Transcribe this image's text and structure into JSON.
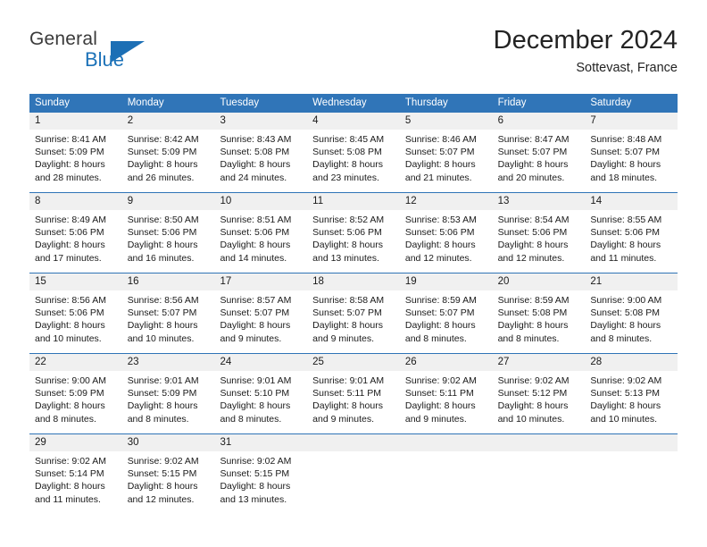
{
  "brand": {
    "word1": "General",
    "word2": "Blue",
    "logo_icon": "blue-triangle-icon",
    "accent_color": "#1c72b8"
  },
  "header": {
    "title": "December 2024",
    "subtitle": "Sottevast, France"
  },
  "theme": {
    "header_row_color": "#3075b8",
    "day_band_color": "#f0f0f0",
    "grid_line_color": "#2f74b6",
    "text_color": "#1a1a1a"
  },
  "calendar": {
    "weekday_headers": [
      "Sunday",
      "Monday",
      "Tuesday",
      "Wednesday",
      "Thursday",
      "Friday",
      "Saturday"
    ],
    "weeks": [
      [
        {
          "day": "1",
          "lines": [
            "Sunrise: 8:41 AM",
            "Sunset: 5:09 PM",
            "Daylight: 8 hours",
            "and 28 minutes."
          ]
        },
        {
          "day": "2",
          "lines": [
            "Sunrise: 8:42 AM",
            "Sunset: 5:09 PM",
            "Daylight: 8 hours",
            "and 26 minutes."
          ]
        },
        {
          "day": "3",
          "lines": [
            "Sunrise: 8:43 AM",
            "Sunset: 5:08 PM",
            "Daylight: 8 hours",
            "and 24 minutes."
          ]
        },
        {
          "day": "4",
          "lines": [
            "Sunrise: 8:45 AM",
            "Sunset: 5:08 PM",
            "Daylight: 8 hours",
            "and 23 minutes."
          ]
        },
        {
          "day": "5",
          "lines": [
            "Sunrise: 8:46 AM",
            "Sunset: 5:07 PM",
            "Daylight: 8 hours",
            "and 21 minutes."
          ]
        },
        {
          "day": "6",
          "lines": [
            "Sunrise: 8:47 AM",
            "Sunset: 5:07 PM",
            "Daylight: 8 hours",
            "and 20 minutes."
          ]
        },
        {
          "day": "7",
          "lines": [
            "Sunrise: 8:48 AM",
            "Sunset: 5:07 PM",
            "Daylight: 8 hours",
            "and 18 minutes."
          ]
        }
      ],
      [
        {
          "day": "8",
          "lines": [
            "Sunrise: 8:49 AM",
            "Sunset: 5:06 PM",
            "Daylight: 8 hours",
            "and 17 minutes."
          ]
        },
        {
          "day": "9",
          "lines": [
            "Sunrise: 8:50 AM",
            "Sunset: 5:06 PM",
            "Daylight: 8 hours",
            "and 16 minutes."
          ]
        },
        {
          "day": "10",
          "lines": [
            "Sunrise: 8:51 AM",
            "Sunset: 5:06 PM",
            "Daylight: 8 hours",
            "and 14 minutes."
          ]
        },
        {
          "day": "11",
          "lines": [
            "Sunrise: 8:52 AM",
            "Sunset: 5:06 PM",
            "Daylight: 8 hours",
            "and 13 minutes."
          ]
        },
        {
          "day": "12",
          "lines": [
            "Sunrise: 8:53 AM",
            "Sunset: 5:06 PM",
            "Daylight: 8 hours",
            "and 12 minutes."
          ]
        },
        {
          "day": "13",
          "lines": [
            "Sunrise: 8:54 AM",
            "Sunset: 5:06 PM",
            "Daylight: 8 hours",
            "and 12 minutes."
          ]
        },
        {
          "day": "14",
          "lines": [
            "Sunrise: 8:55 AM",
            "Sunset: 5:06 PM",
            "Daylight: 8 hours",
            "and 11 minutes."
          ]
        }
      ],
      [
        {
          "day": "15",
          "lines": [
            "Sunrise: 8:56 AM",
            "Sunset: 5:06 PM",
            "Daylight: 8 hours",
            "and 10 minutes."
          ]
        },
        {
          "day": "16",
          "lines": [
            "Sunrise: 8:56 AM",
            "Sunset: 5:07 PM",
            "Daylight: 8 hours",
            "and 10 minutes."
          ]
        },
        {
          "day": "17",
          "lines": [
            "Sunrise: 8:57 AM",
            "Sunset: 5:07 PM",
            "Daylight: 8 hours",
            "and 9 minutes."
          ]
        },
        {
          "day": "18",
          "lines": [
            "Sunrise: 8:58 AM",
            "Sunset: 5:07 PM",
            "Daylight: 8 hours",
            "and 9 minutes."
          ]
        },
        {
          "day": "19",
          "lines": [
            "Sunrise: 8:59 AM",
            "Sunset: 5:07 PM",
            "Daylight: 8 hours",
            "and 8 minutes."
          ]
        },
        {
          "day": "20",
          "lines": [
            "Sunrise: 8:59 AM",
            "Sunset: 5:08 PM",
            "Daylight: 8 hours",
            "and 8 minutes."
          ]
        },
        {
          "day": "21",
          "lines": [
            "Sunrise: 9:00 AM",
            "Sunset: 5:08 PM",
            "Daylight: 8 hours",
            "and 8 minutes."
          ]
        }
      ],
      [
        {
          "day": "22",
          "lines": [
            "Sunrise: 9:00 AM",
            "Sunset: 5:09 PM",
            "Daylight: 8 hours",
            "and 8 minutes."
          ]
        },
        {
          "day": "23",
          "lines": [
            "Sunrise: 9:01 AM",
            "Sunset: 5:09 PM",
            "Daylight: 8 hours",
            "and 8 minutes."
          ]
        },
        {
          "day": "24",
          "lines": [
            "Sunrise: 9:01 AM",
            "Sunset: 5:10 PM",
            "Daylight: 8 hours",
            "and 8 minutes."
          ]
        },
        {
          "day": "25",
          "lines": [
            "Sunrise: 9:01 AM",
            "Sunset: 5:11 PM",
            "Daylight: 8 hours",
            "and 9 minutes."
          ]
        },
        {
          "day": "26",
          "lines": [
            "Sunrise: 9:02 AM",
            "Sunset: 5:11 PM",
            "Daylight: 8 hours",
            "and 9 minutes."
          ]
        },
        {
          "day": "27",
          "lines": [
            "Sunrise: 9:02 AM",
            "Sunset: 5:12 PM",
            "Daylight: 8 hours",
            "and 10 minutes."
          ]
        },
        {
          "day": "28",
          "lines": [
            "Sunrise: 9:02 AM",
            "Sunset: 5:13 PM",
            "Daylight: 8 hours",
            "and 10 minutes."
          ]
        }
      ],
      [
        {
          "day": "29",
          "lines": [
            "Sunrise: 9:02 AM",
            "Sunset: 5:14 PM",
            "Daylight: 8 hours",
            "and 11 minutes."
          ]
        },
        {
          "day": "30",
          "lines": [
            "Sunrise: 9:02 AM",
            "Sunset: 5:15 PM",
            "Daylight: 8 hours",
            "and 12 minutes."
          ]
        },
        {
          "day": "31",
          "lines": [
            "Sunrise: 9:02 AM",
            "Sunset: 5:15 PM",
            "Daylight: 8 hours",
            "and 13 minutes."
          ]
        },
        {
          "day": "",
          "lines": []
        },
        {
          "day": "",
          "lines": []
        },
        {
          "day": "",
          "lines": []
        },
        {
          "day": "",
          "lines": []
        }
      ]
    ]
  }
}
